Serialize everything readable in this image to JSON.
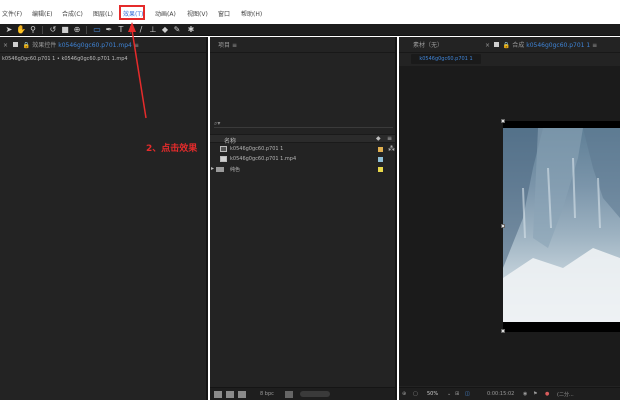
{
  "menu": {
    "items": [
      {
        "label": "文件(F)"
      },
      {
        "label": "编辑(E)"
      },
      {
        "label": "合成(C)"
      },
      {
        "label": "图层(L)"
      },
      {
        "label": "效果(T)"
      },
      {
        "label": "动画(A)"
      },
      {
        "label": "视图(V)"
      },
      {
        "label": "窗口"
      },
      {
        "label": "帮助(H)"
      }
    ]
  },
  "toolbar": {
    "tools": [
      "selection-tool",
      "hand-tool",
      "zoom-tool",
      "rotate-tool",
      "camera-tool",
      "pan-behind-tool",
      "rectangle-tool",
      "pen-tool",
      "type-tool",
      "brush-tool",
      "clone-stamp-tool",
      "eraser-tool",
      "roto-brush-tool",
      "puppet-pin-tool"
    ]
  },
  "effects_panel": {
    "tab_prefix": "效果控件",
    "tab_file": "k0546g0gc60.p701.mp4",
    "path": "k0546g0gc60.p701 1 • k0546g0gc60.p701 1.mp4"
  },
  "project_panel": {
    "tab": "项目",
    "search_icon": "search-icon",
    "column_name": "名称",
    "rows": [
      {
        "name": "k0546g0gc60.p701 1",
        "type": "composition",
        "label_color": "#e0b050"
      },
      {
        "name": "k0546g0gc60.p701 1.mp4",
        "type": "footage",
        "label_color": "#8fbfd6"
      },
      {
        "name": "纯色",
        "type": "folder",
        "label_color": "#e8d84a"
      }
    ],
    "bottom_bar": {
      "bpc": "8 bpc"
    }
  },
  "comp_panel": {
    "footage_tab": "素材（无）",
    "comp_tab_prefix": "合成",
    "comp_tab_name": "k0546g0gc60.p701 1",
    "subtab": "k0546g0gc60.p701 1",
    "zoom": "50%",
    "timecode": "0:00:15:02",
    "resolution": "(二分..."
  },
  "annotation": {
    "text": "2、点击效果",
    "color": "#e52b2b"
  }
}
